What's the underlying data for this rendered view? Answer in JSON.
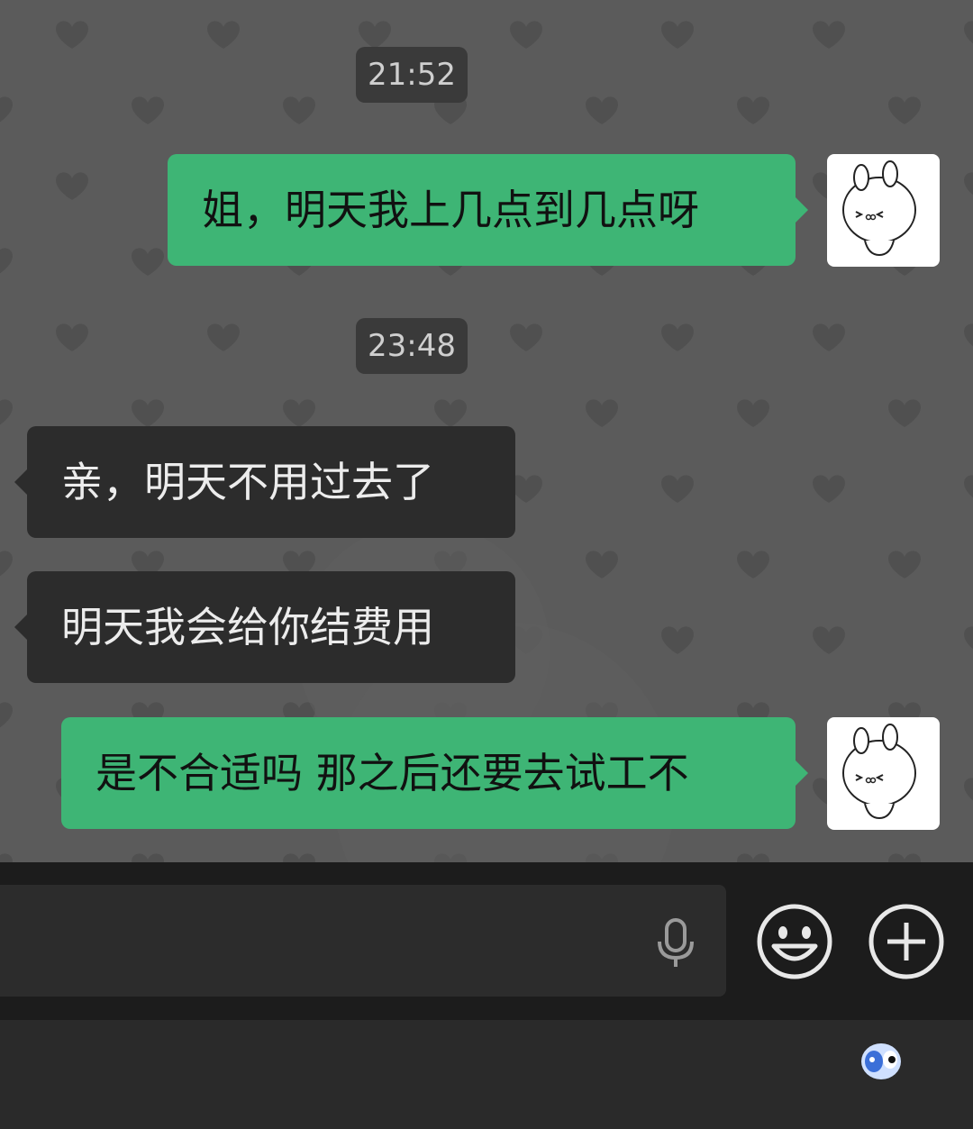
{
  "timestamps": [
    "21:52",
    "23:48"
  ],
  "messages": [
    {
      "direction": "outgoing",
      "text": "姐，明天我上几点到几点呀"
    },
    {
      "direction": "incoming",
      "text": "亲，明天不用过去了"
    },
    {
      "direction": "incoming",
      "text": "明天我会给你结费用"
    },
    {
      "direction": "outgoing",
      "text": "是不合适吗 那之后还要去试工不"
    }
  ],
  "input_bar": {
    "icons": [
      "microphone-icon",
      "emoji-icon",
      "plus-icon"
    ]
  },
  "colors": {
    "outgoing_bubble": "#3eb575",
    "incoming_bubble": "#2c2c2c",
    "chat_background": "#5b5b5b",
    "input_bar": "#1c1c1c"
  }
}
